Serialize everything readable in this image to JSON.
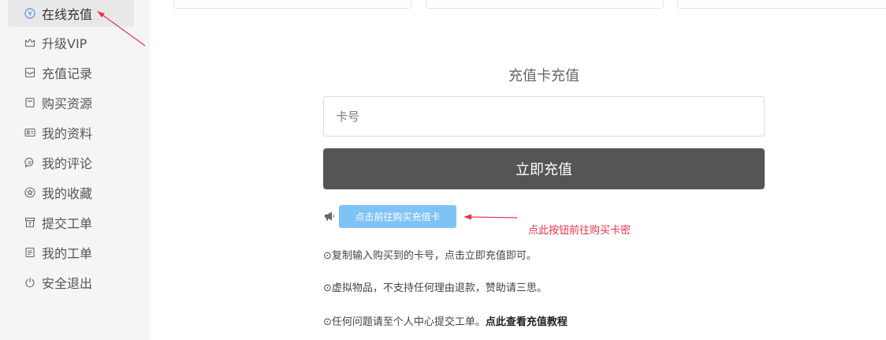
{
  "sidebar": {
    "items": [
      {
        "label": "在线充值",
        "icon": "yen-circle-icon",
        "active": true
      },
      {
        "label": "升级VIP",
        "icon": "crown-icon"
      },
      {
        "label": "充值记录",
        "icon": "inbox-icon"
      },
      {
        "label": "购买资源",
        "icon": "shopping-bag-icon"
      },
      {
        "label": "我的资料",
        "icon": "id-card-icon"
      },
      {
        "label": "我的评论",
        "icon": "chat-icon"
      },
      {
        "label": "我的收藏",
        "icon": "star-circle-icon"
      },
      {
        "label": "提交工单",
        "icon": "ticket-icon"
      },
      {
        "label": "我的工单",
        "icon": "document-icon"
      },
      {
        "label": "安全退出",
        "icon": "power-icon"
      }
    ]
  },
  "main": {
    "title": "充值卡充值",
    "card_input": {
      "placeholder": "卡号",
      "value": ""
    },
    "submit_label": "立即充值",
    "buy_card_label": "点击前往购买充值卡",
    "annotation": "点此按钮前往购买卡密",
    "info": [
      {
        "text": "⊙复制输入购买到的卡号，点击立即充值即可。"
      },
      {
        "text": "⊙虚拟物品，不支持任何理由退款，赞助请三思。"
      },
      {
        "text": "⊙任何问题请至个人中心提交工单。",
        "link": "点此查看充值教程"
      }
    ]
  },
  "colors": {
    "sidebar_bg": "#f5f5f5",
    "active_bg": "#e8e8e8",
    "primary_button": "#555555",
    "buy_button": "#7fc3f5",
    "annotation_red": "#e8344e"
  }
}
